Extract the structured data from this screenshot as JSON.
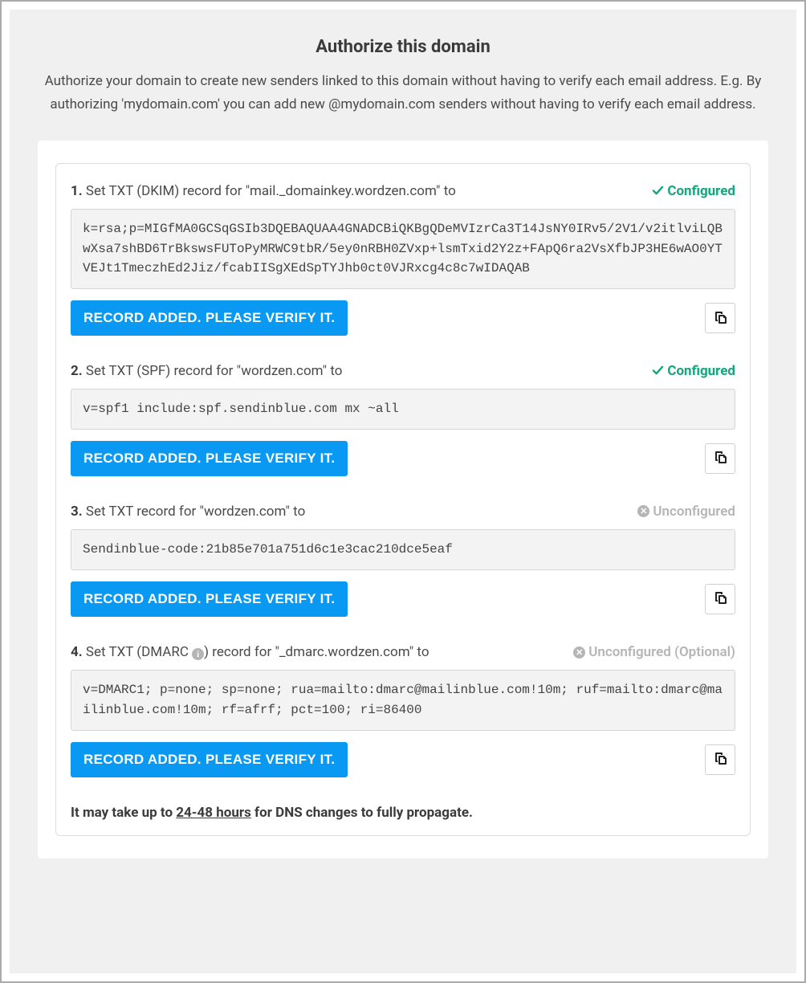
{
  "header": {
    "title": "Authorize this domain",
    "subtitle": "Authorize your domain to create new senders linked to this domain without having to verify each email address. E.g. By authorizing 'mydomain.com' you can add new @mydomain.com senders without having to verify each email address."
  },
  "status_labels": {
    "configured": "Configured",
    "unconfigured": "Unconfigured",
    "unconfigured_optional": "Unconfigured (Optional)"
  },
  "verify_button_label": "RECORD ADDED. PLEASE VERIFY IT.",
  "records": [
    {
      "num": "1.",
      "instr_prefix": " Set TXT (DKIM) record for \"mail._domainkey.wordzen.com\" to",
      "status": "configured",
      "value": "k=rsa;p=MIGfMA0GCSqGSIb3DQEBAQUAA4GNADCBiQKBgQDeMVIzrCa3T14JsNY0IRv5/2V1/v2itlviLQBwXsa7shBD6TrBkswsFUToPyMRWC9tbR/5ey0nRBH0ZVxp+lsmTxid2Y2z+FApQ6ra2VsXfbJP3HE6wAO0YTVEJt1TmeczhEd2Jiz/fcabIISgXEdSpTYJhb0ct0VJRxcg4c8c7wIDAQAB"
    },
    {
      "num": "2.",
      "instr_prefix": " Set TXT (SPF) record for \"wordzen.com\" to",
      "status": "configured",
      "value": "v=spf1 include:spf.sendinblue.com mx ~all"
    },
    {
      "num": "3.",
      "instr_prefix": " Set TXT record for \"wordzen.com\" to",
      "status": "unconfigured",
      "value": "Sendinblue-code:21b85e701a751d6c1e3cac210dce5eaf"
    },
    {
      "num": "4.",
      "instr_html_prefix": " Set TXT (DMARC ",
      "instr_html_suffix": ") record for \"_dmarc.wordzen.com\" to",
      "has_info_icon": true,
      "status": "unconfigured_optional",
      "value": "v=DMARC1; p=none; sp=none; rua=mailto:dmarc@mailinblue.com!10m; ruf=mailto:dmarc@mailinblue.com!10m; rf=afrf; pct=100; ri=86400"
    }
  ],
  "propagation_note": {
    "before": "It may take up to ",
    "hours": "24-48 hours",
    "after": " for DNS changes to fully propagate."
  }
}
